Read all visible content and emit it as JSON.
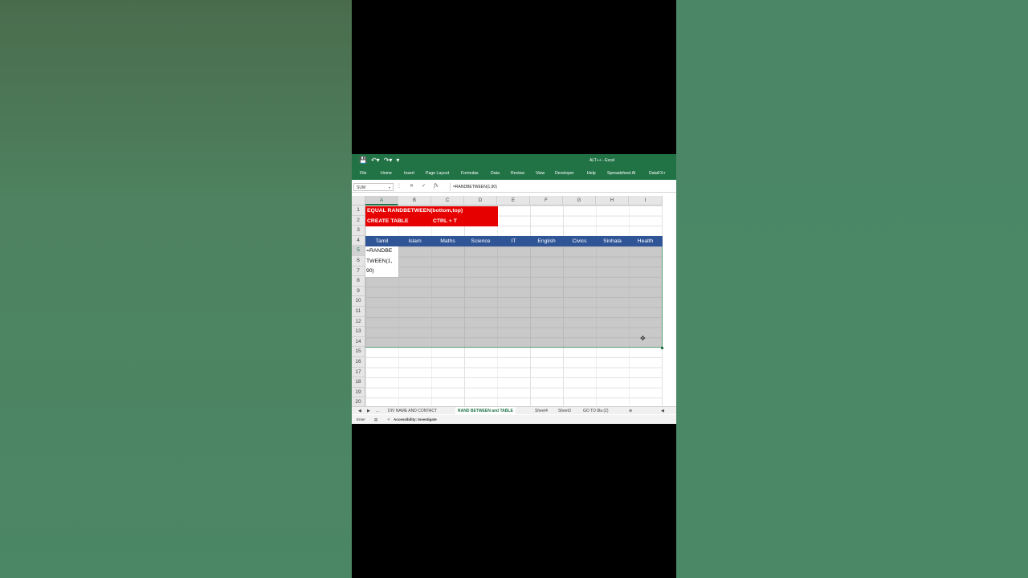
{
  "window": {
    "title": "ALT++  -  Excel"
  },
  "ribbon": {
    "tabs": [
      "File",
      "Home",
      "Insert",
      "Page Layout",
      "Formulas",
      "Data",
      "Review",
      "View",
      "Developer",
      "Help",
      "Spreadsheet AI",
      "DataFX+"
    ]
  },
  "formula_bar": {
    "name_box": "SUM",
    "formula": "=RANDBETWEEN(1,90)",
    "fx_label": "fx"
  },
  "columns": [
    "A",
    "B",
    "C",
    "D",
    "E",
    "F",
    "G",
    "H",
    "I"
  ],
  "rows": [
    "1",
    "2",
    "3",
    "4",
    "5",
    "6",
    "7",
    "8",
    "9",
    "10",
    "11",
    "12",
    "13",
    "14",
    "15",
    "16",
    "17",
    "18",
    "19",
    "20"
  ],
  "notes": {
    "line1": "EQUAL RANDBETWEEN(bottom,top)",
    "line2a": "CREATE TABLE",
    "line2b": "CTRL + T"
  },
  "table": {
    "headers": [
      "Tamil",
      "Islam",
      "Maths",
      "Science",
      "IT",
      "English",
      "Civics",
      "Sinhala",
      "Health"
    ]
  },
  "active_cell": {
    "lines": [
      "=RANDBE",
      "TWEEN(1,",
      "90)"
    ]
  },
  "sheets": {
    "more": "...",
    "tabs": [
      "DIV NAME AND CONTACT",
      "RAND BETWEEN and TABLE",
      "Sheet4",
      "Sheet3",
      "GO TO 8la (2)"
    ],
    "active": "RAND BETWEEN and TABLE"
  },
  "status": {
    "mode": "Enter",
    "accessibility": "Accessibility: Investigate"
  },
  "colors": {
    "excel_green": "#217346",
    "note_red": "#e60000",
    "table_header": "#2f5597"
  }
}
